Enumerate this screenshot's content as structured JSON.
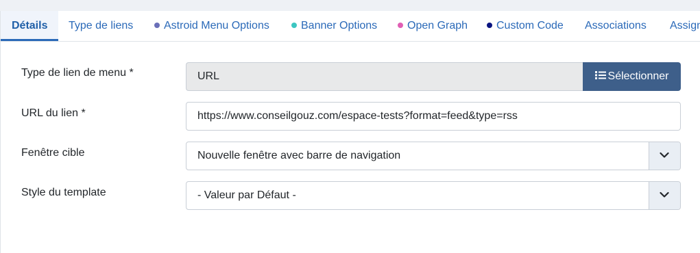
{
  "tabs": [
    {
      "label": "Détails",
      "active": true
    },
    {
      "label": "Type de liens"
    },
    {
      "label": "Astroid Menu Options",
      "dot_color": "#6a6fb8"
    },
    {
      "label": "Banner Options",
      "dot_color": "#3cc6c1"
    },
    {
      "label": "Open Graph",
      "dot_color": "#e05fb4"
    },
    {
      "label": "Custom Code",
      "dot_color": "#0a1480"
    },
    {
      "label": "Associations"
    },
    {
      "label": "Assign"
    }
  ],
  "form": {
    "menu_link_type": {
      "label": "Type de lien de menu *",
      "value": "URL",
      "button_label": "Sélectionner",
      "button_icon": "list-icon"
    },
    "link_url": {
      "label": "URL du lien *",
      "value": "https://www.conseilgouz.com/espace-tests?format=feed&type=rss"
    },
    "target_window": {
      "label": "Fenêtre cible",
      "value": "Nouvelle fenêtre avec barre de navigation"
    },
    "template_style": {
      "label": "Style du template",
      "value": "- Valeur par Défaut -"
    }
  },
  "colors": {
    "accent": "#2a69b8",
    "button": "#3e5f8a"
  }
}
